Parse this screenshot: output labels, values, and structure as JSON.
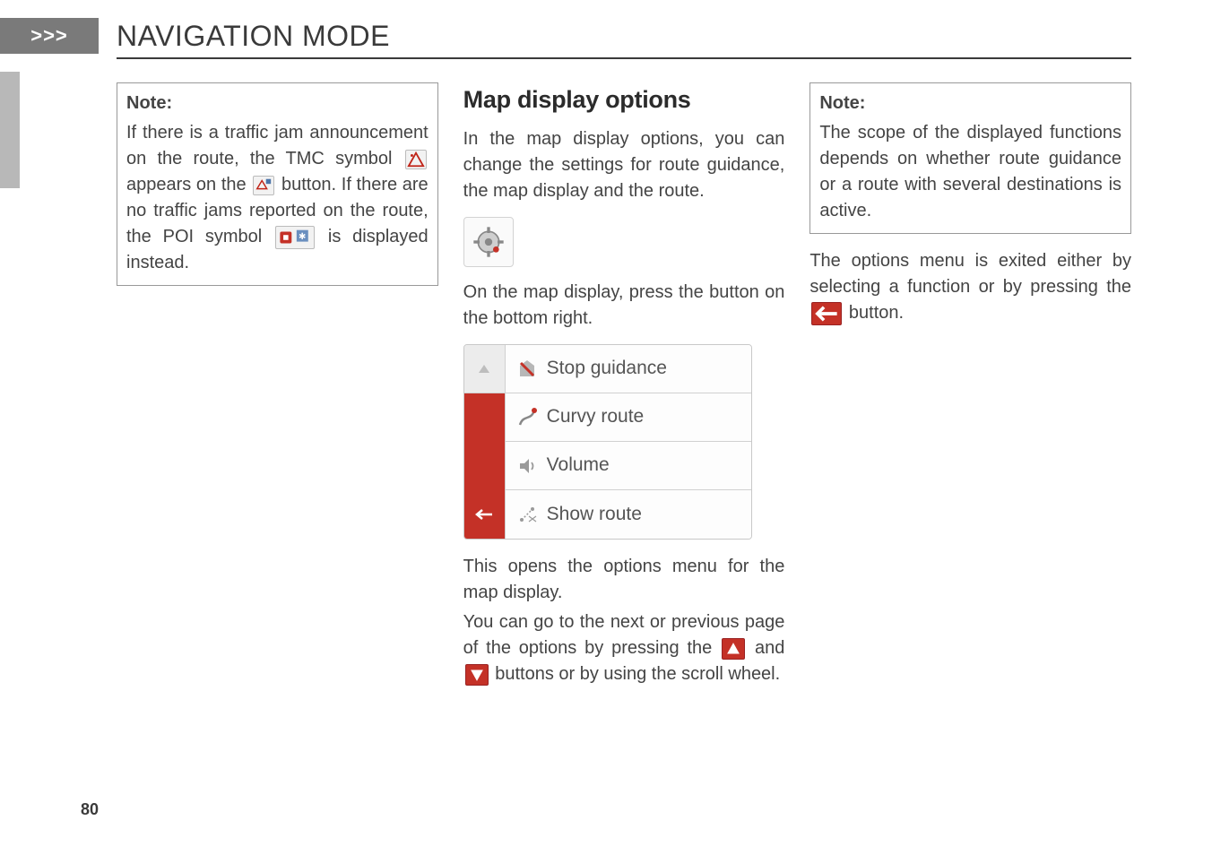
{
  "header": {
    "arrows": ">>>",
    "title": "NAVIGATION MODE"
  },
  "col1": {
    "note_heading": "Note:",
    "note_pre": "If there is a traffic jam announcement on the route, the TMC symbol ",
    "note_mid1": " appears on the ",
    "note_mid2": " button. If there are no traffic jams reported on the route, the POI symbol ",
    "note_end": " is displayed instead."
  },
  "col2": {
    "section_heading": "Map display options",
    "p1": "In the map display options, you can change the settings for route guidance, the map display and the route.",
    "p2": "On the map display, press the button on the bottom right.",
    "menu": {
      "item1": "Stop guidance",
      "item2": "Curvy route",
      "item3": "Volume",
      "item4": "Show route"
    },
    "p3": "This opens the options menu for the map display.",
    "p4_pre": "You can go to the next or previous page of the options by pressing the ",
    "p4_mid": " and ",
    "p4_post": " buttons or by using the scroll wheel."
  },
  "col3": {
    "note_heading": "Note:",
    "note_body": "The scope of the displayed functions depends on whether route guidance or a route with several destinations is active.",
    "p1_pre": "The options menu is exited either by selecting a function or by pressing the ",
    "p1_post": " button."
  },
  "page_number": "80"
}
